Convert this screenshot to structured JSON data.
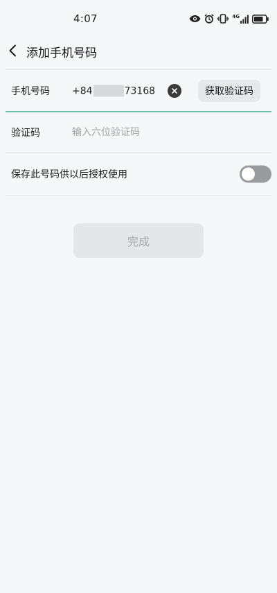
{
  "status_bar": {
    "time": "4:07",
    "network": "4G",
    "icons": [
      "eye-icon",
      "alarm-icon",
      "vibrate-icon",
      "signal-icon",
      "battery-icon"
    ]
  },
  "header": {
    "title": "添加手机号码",
    "back_icon": "chevron-left-icon"
  },
  "phone": {
    "label": "手机号码",
    "prefix": "+84",
    "suffix": "73168",
    "clear_icon": "close-icon",
    "get_code_label": "获取验证码"
  },
  "code": {
    "label": "验证码",
    "placeholder": "输入六位验证码"
  },
  "save": {
    "label": "保存此号码供以后授权使用",
    "enabled": false
  },
  "actions": {
    "done_label": "完成"
  },
  "colors": {
    "background": "#f6f7f9",
    "focus_line": "#6fbfa4",
    "button_bg": "#e7e8ea",
    "done_text_disabled": "#a7a8ac",
    "toggle_off": "#9a9b9f"
  }
}
